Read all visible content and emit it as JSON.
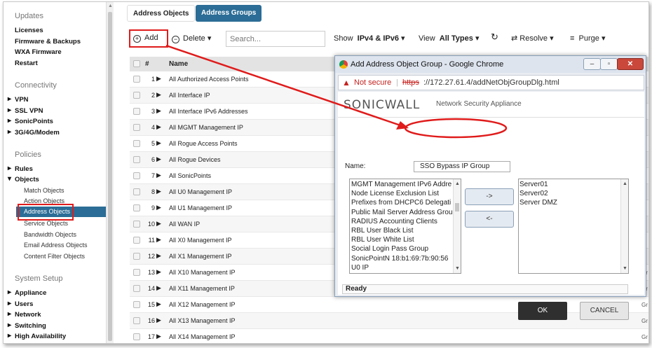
{
  "sidebar": {
    "sections": [
      {
        "title": "Updates",
        "items": [
          {
            "label": "Licenses"
          },
          {
            "label": "Firmware & Backups"
          },
          {
            "label": "WXA Firmware"
          },
          {
            "label": "Restart"
          }
        ]
      },
      {
        "title": "Connectivity",
        "items": [
          {
            "label": "VPN"
          },
          {
            "label": "SSL VPN"
          },
          {
            "label": "SonicPoints"
          },
          {
            "label": "3G/4G/Modem"
          }
        ]
      },
      {
        "title": "Policies",
        "items": [
          {
            "label": "Rules"
          },
          {
            "label": "Objects"
          }
        ],
        "sub_items": [
          {
            "label": "Match Objects"
          },
          {
            "label": "Action Objects"
          },
          {
            "label": "Address Objects"
          },
          {
            "label": "Service Objects"
          },
          {
            "label": "Bandwidth Objects"
          },
          {
            "label": "Email Address Objects"
          },
          {
            "label": "Content Filter Objects"
          }
        ]
      },
      {
        "title": "System Setup",
        "items": [
          {
            "label": "Appliance"
          },
          {
            "label": "Users"
          },
          {
            "label": "Network"
          },
          {
            "label": "Switching"
          },
          {
            "label": "High Availability"
          }
        ]
      }
    ]
  },
  "tabs": [
    {
      "label": "Address Objects"
    },
    {
      "label": "Address Groups"
    }
  ],
  "toolbar": {
    "add_label": "Add",
    "delete_label": "Delete",
    "search_placeholder": "Search...",
    "show_label": "Show",
    "show_value": "IPv4 & IPv6",
    "view_label": "View",
    "view_value": "All Types",
    "resolve_label": "Resolve",
    "purge_label": "Purge"
  },
  "table": {
    "col_num": "#",
    "col_name": "Name",
    "rows": [
      {
        "num": "1",
        "name": "All Authorized Access Points"
      },
      {
        "num": "2",
        "name": "All Interface IP"
      },
      {
        "num": "3",
        "name": "All Interface IPv6 Addresses"
      },
      {
        "num": "4",
        "name": "All MGMT Management IP"
      },
      {
        "num": "5",
        "name": "All Rogue Access Points"
      },
      {
        "num": "6",
        "name": "All Rogue Devices"
      },
      {
        "num": "7",
        "name": "All SonicPoints"
      },
      {
        "num": "8",
        "name": "All U0 Management IP"
      },
      {
        "num": "9",
        "name": "All U1 Management IP"
      },
      {
        "num": "10",
        "name": "All WAN IP"
      },
      {
        "num": "11",
        "name": "All X0 Management IP"
      },
      {
        "num": "12",
        "name": "All X1 Management IP"
      },
      {
        "num": "13",
        "name": "All X10 Management IP"
      },
      {
        "num": "14",
        "name": "All X11 Management IP"
      },
      {
        "num": "15",
        "name": "All X12 Management IP"
      },
      {
        "num": "16",
        "name": "All X13 Management IP"
      },
      {
        "num": "17",
        "name": "All X14 Management IP"
      }
    ],
    "edge_text": [
      "Gr",
      "Gr",
      "Gr",
      "Gr",
      "Gr"
    ]
  },
  "dialog": {
    "title": "Add Address Object Group - Google Chrome",
    "not_secure": "Not secure",
    "url_scheme": "https",
    "url_rest": "://172.27.61.4/addNetObjGroupDlg.html",
    "brand": "SONICWALL",
    "subtitle": "Network Security Appliance",
    "name_label": "Name:",
    "name_value": "SSO Bypass IP Group",
    "left_list": [
      "MGMT Management IPv6 Addre",
      "Node License Exclusion List",
      "Prefixes from DHCPC6 Delegati",
      "Public Mail Server Address Grou",
      "RADIUS Accounting Clients",
      "RBL User Black List",
      "RBL User White List",
      "Social Login Pass Group",
      "SonicPointN 18:b1:69:7b:90:56",
      "U0 IP"
    ],
    "right_list": [
      "Server01",
      "Server02",
      "Server DMZ"
    ],
    "add_arrow": "->",
    "remove_arrow": "<-",
    "status": "Ready",
    "ok_label": "OK",
    "cancel_label": "CANCEL"
  }
}
